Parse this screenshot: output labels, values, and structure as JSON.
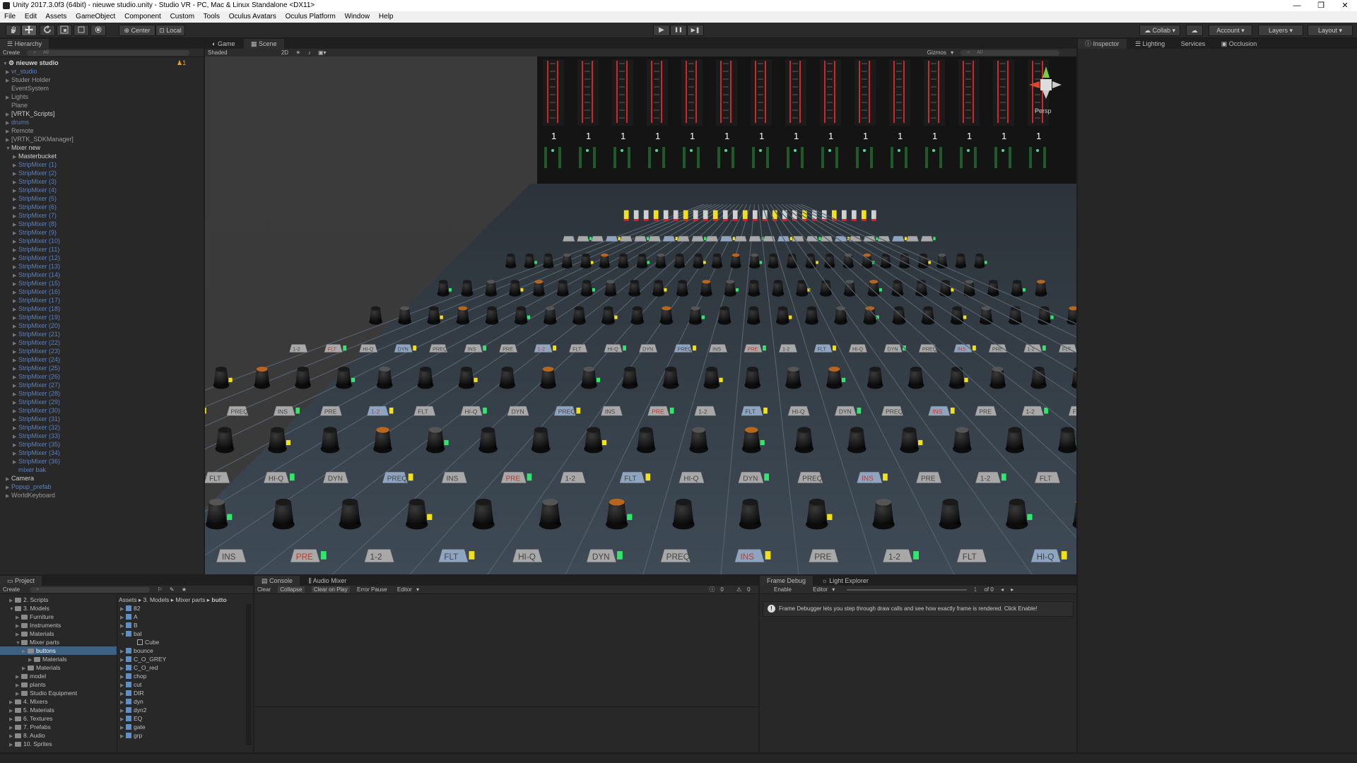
{
  "window": {
    "title": "Unity 2017.3.0f3 (64bit) - nieuwe studio.unity - Studio VR - PC, Mac & Linux Standalone <DX11>",
    "minimize": "—",
    "restore": "❐",
    "close": "✕"
  },
  "menu": [
    "File",
    "Edit",
    "Assets",
    "GameObject",
    "Component",
    "Custom",
    "Tools",
    "Oculus Avatars",
    "Oculus Platform",
    "Window",
    "Help"
  ],
  "toolbar": {
    "center_label": "Center",
    "local_label": "Local",
    "play": "▶",
    "pause": "❚❚",
    "step": "▶❚",
    "collab_label": "Collab",
    "account_label": "Account",
    "layers_label": "Layers",
    "layout_label": "Layout"
  },
  "hierarchy": {
    "tab": "Hierarchy",
    "create": "Create",
    "search_placeholder": "All",
    "scene_name": "nieuwe studio",
    "scene_badge": "1",
    "items": [
      {
        "label": "vr_studio",
        "style": "blue",
        "indent": 1,
        "arrow": true
      },
      {
        "label": "Studer Holder",
        "style": "gray",
        "indent": 1,
        "arrow": true
      },
      {
        "label": "EventSystem",
        "style": "gray",
        "indent": 1,
        "arrow": false
      },
      {
        "label": "Lights",
        "style": "gray",
        "indent": 1,
        "arrow": true
      },
      {
        "label": "Plane",
        "style": "gray",
        "indent": 1,
        "arrow": false
      },
      {
        "label": "[VRTK_Scripts]",
        "style": "white",
        "indent": 1,
        "arrow": true
      },
      {
        "label": "drums",
        "style": "blue",
        "indent": 1,
        "arrow": true
      },
      {
        "label": "Remote",
        "style": "gray",
        "indent": 1,
        "arrow": true
      },
      {
        "label": "[VRTK_SDKManager]",
        "style": "gray",
        "indent": 1,
        "arrow": true
      },
      {
        "label": "Mixer new",
        "style": "white",
        "indent": 1,
        "arrow": true,
        "open": true
      },
      {
        "label": "Masterbucket",
        "style": "white",
        "indent": 2,
        "arrow": true
      },
      {
        "label": "StripMixer (1)",
        "style": "blue",
        "indent": 2,
        "arrow": true
      },
      {
        "label": "StripMixer (2)",
        "style": "blue",
        "indent": 2,
        "arrow": true
      },
      {
        "label": "StripMixer (3)",
        "style": "blue",
        "indent": 2,
        "arrow": true
      },
      {
        "label": "StripMixer (4)",
        "style": "blue",
        "indent": 2,
        "arrow": true
      },
      {
        "label": "StripMixer (5)",
        "style": "blue",
        "indent": 2,
        "arrow": true
      },
      {
        "label": "StripMixer (6)",
        "style": "blue",
        "indent": 2,
        "arrow": true
      },
      {
        "label": "StripMixer (7)",
        "style": "blue",
        "indent": 2,
        "arrow": true
      },
      {
        "label": "StripMixer (8)",
        "style": "blue",
        "indent": 2,
        "arrow": true
      },
      {
        "label": "StripMixer (9)",
        "style": "blue",
        "indent": 2,
        "arrow": true
      },
      {
        "label": "StripMixer (10)",
        "style": "blue",
        "indent": 2,
        "arrow": true
      },
      {
        "label": "StripMixer (11)",
        "style": "blue",
        "indent": 2,
        "arrow": true
      },
      {
        "label": "StripMixer (12)",
        "style": "blue",
        "indent": 2,
        "arrow": true
      },
      {
        "label": "StripMixer (13)",
        "style": "blue",
        "indent": 2,
        "arrow": true
      },
      {
        "label": "StripMixer (14)",
        "style": "blue",
        "indent": 2,
        "arrow": true
      },
      {
        "label": "StripMixer (15)",
        "style": "blue",
        "indent": 2,
        "arrow": true
      },
      {
        "label": "StripMixer (16)",
        "style": "blue",
        "indent": 2,
        "arrow": true
      },
      {
        "label": "StripMixer (17)",
        "style": "blue",
        "indent": 2,
        "arrow": true
      },
      {
        "label": "StripMixer (18)",
        "style": "blue",
        "indent": 2,
        "arrow": true
      },
      {
        "label": "StripMixer (19)",
        "style": "blue",
        "indent": 2,
        "arrow": true
      },
      {
        "label": "StripMixer (20)",
        "style": "blue",
        "indent": 2,
        "arrow": true
      },
      {
        "label": "StripMixer (21)",
        "style": "blue",
        "indent": 2,
        "arrow": true
      },
      {
        "label": "StripMixer (22)",
        "style": "blue",
        "indent": 2,
        "arrow": true
      },
      {
        "label": "StripMixer (23)",
        "style": "blue",
        "indent": 2,
        "arrow": true
      },
      {
        "label": "StripMixer (24)",
        "style": "blue",
        "indent": 2,
        "arrow": true
      },
      {
        "label": "StripMixer (25)",
        "style": "blue",
        "indent": 2,
        "arrow": true
      },
      {
        "label": "StripMixer (26)",
        "style": "blue",
        "indent": 2,
        "arrow": true
      },
      {
        "label": "StripMixer (27)",
        "style": "blue",
        "indent": 2,
        "arrow": true
      },
      {
        "label": "StripMixer (28)",
        "style": "blue",
        "indent": 2,
        "arrow": true
      },
      {
        "label": "StripMixer (29)",
        "style": "blue",
        "indent": 2,
        "arrow": true
      },
      {
        "label": "StripMixer (30)",
        "style": "blue",
        "indent": 2,
        "arrow": true
      },
      {
        "label": "StripMixer (31)",
        "style": "blue",
        "indent": 2,
        "arrow": true
      },
      {
        "label": "StripMixer (32)",
        "style": "blue",
        "indent": 2,
        "arrow": true
      },
      {
        "label": "StripMixer (33)",
        "style": "blue",
        "indent": 2,
        "arrow": true
      },
      {
        "label": "StripMixer (35)",
        "style": "blue",
        "indent": 2,
        "arrow": true
      },
      {
        "label": "StripMixer (34)",
        "style": "blue",
        "indent": 2,
        "arrow": true
      },
      {
        "label": "StripMixer (36)",
        "style": "blue",
        "indent": 2,
        "arrow": true
      },
      {
        "label": "mixer bak",
        "style": "blue",
        "indent": 2,
        "arrow": false
      },
      {
        "label": "Camera",
        "style": "white",
        "indent": 1,
        "arrow": true
      },
      {
        "label": "Popup_prefab",
        "style": "blue",
        "indent": 1,
        "arrow": true
      },
      {
        "label": "WorldKeyboard",
        "style": "gray",
        "indent": 1,
        "arrow": true
      }
    ]
  },
  "scene_view": {
    "tabs": [
      "Game",
      "Scene"
    ],
    "shading": "Shaded",
    "mode_2d": "2D",
    "gizmos": "Gizmos",
    "search_placeholder": "All",
    "persp_label": "Persp",
    "channel_number": "1",
    "channel_count": 15,
    "button_labels": [
      "HI-Q",
      "DYN",
      "PREQ",
      "INS",
      "PRE",
      "1-2",
      "FLT"
    ]
  },
  "inspector": {
    "tabs": [
      "Inspector",
      "Lighting",
      "Services",
      "Occlusion"
    ]
  },
  "project": {
    "tab": "Project",
    "create": "Create",
    "tree": [
      {
        "label": "2. Scripts",
        "indent": 1
      },
      {
        "label": "3. Models",
        "indent": 1,
        "open": true
      },
      {
        "label": "Furniture",
        "indent": 2
      },
      {
        "label": "Instruments",
        "indent": 2
      },
      {
        "label": "Materials",
        "indent": 2
      },
      {
        "label": "Mixer parts",
        "indent": 2,
        "open": true
      },
      {
        "label": "buttons",
        "indent": 3,
        "selected": true
      },
      {
        "label": "Materials",
        "indent": 4
      },
      {
        "label": "Materials",
        "indent": 3
      },
      {
        "label": "model",
        "indent": 2
      },
      {
        "label": "plants",
        "indent": 2
      },
      {
        "label": "Studio Equipment",
        "indent": 2
      },
      {
        "label": "4. Mixers",
        "indent": 1
      },
      {
        "label": "5. Materials",
        "indent": 1
      },
      {
        "label": "6. Textures",
        "indent": 1
      },
      {
        "label": "7. Prefabs",
        "indent": 1
      },
      {
        "label": "8. Audio",
        "indent": 1
      },
      {
        "label": "10. Sprites",
        "indent": 1
      }
    ],
    "breadcrumb": [
      "Assets",
      "3. Models",
      "Mixer parts",
      "butto"
    ],
    "assets": [
      {
        "label": "82",
        "indent": 0
      },
      {
        "label": "A",
        "indent": 0
      },
      {
        "label": "B",
        "indent": 0
      },
      {
        "label": "bal",
        "indent": 0,
        "open": true
      },
      {
        "label": "Cube",
        "indent": 1
      },
      {
        "label": "bounce",
        "indent": 0
      },
      {
        "label": "C_O_GREY",
        "indent": 0
      },
      {
        "label": "C_O_red",
        "indent": 0
      },
      {
        "label": "chop",
        "indent": 0
      },
      {
        "label": "cut",
        "indent": 0
      },
      {
        "label": "DIR",
        "indent": 0
      },
      {
        "label": "dyn",
        "indent": 0
      },
      {
        "label": "dyn2",
        "indent": 0
      },
      {
        "label": "EQ",
        "indent": 0
      },
      {
        "label": "gate",
        "indent": 0
      },
      {
        "label": "grp",
        "indent": 0
      }
    ]
  },
  "console": {
    "tabs": [
      "Console",
      "Audio Mixer"
    ],
    "buttons": [
      "Clear",
      "Collapse",
      "Clear on Play",
      "Error Pause",
      "Editor"
    ],
    "counts": [
      "0",
      "0",
      "0"
    ]
  },
  "frame_debug": {
    "tabs": [
      "Frame Debug",
      "Light Explorer"
    ],
    "enable": "Enable",
    "editor": "Editor",
    "of_label": "of 0",
    "message": "Frame Debugger lets you step through draw calls and see how exactly frame is rendered. Click Enable!"
  }
}
